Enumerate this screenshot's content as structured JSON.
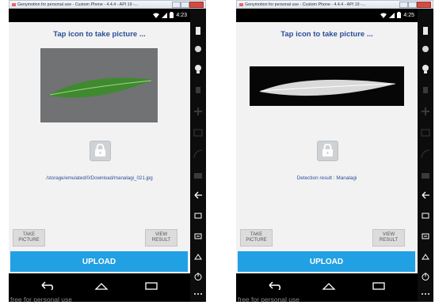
{
  "window_title": "Genymotion for personal use - Custom Phone - 4.4.4 - API 19 -...",
  "status_bar": {
    "left_time": "4:23",
    "right_time": "4:25"
  },
  "left_screen": {
    "header": "Tap icon to take picture ...",
    "file_path": "/storage/emulated/0/Download/manalagi_021.jpg"
  },
  "right_screen": {
    "header": "Tap icon to take picture ...",
    "result": "Detection result : Manalagi"
  },
  "buttons": {
    "take_picture_line1": "TAKE",
    "take_picture_line2": "PICTURE",
    "view_result_line1": "VIEW",
    "view_result_line2": "RESULT",
    "upload": "UPLOAD"
  },
  "watermark": "free for personal use",
  "colors": {
    "title_blue": "#2a4f9a",
    "upload_blue": "#22a0e4",
    "screen_bg": "#f2f2f2"
  },
  "icons": {
    "lock": "lock-icon",
    "wifi": "wifi-icon",
    "signal": "signal-icon",
    "battery": "battery-icon",
    "back": "back-icon",
    "home": "home-icon",
    "recent": "recent-apps-icon"
  }
}
